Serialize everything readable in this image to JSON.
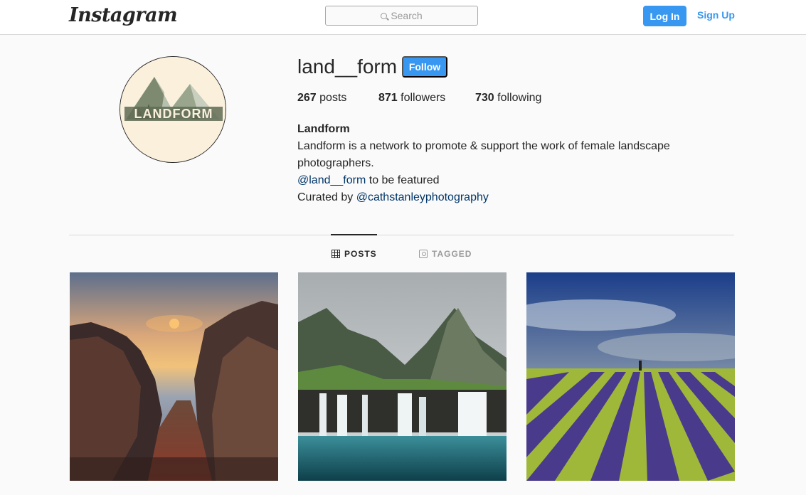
{
  "header": {
    "logo_text": "Instagram",
    "search_placeholder": "Search",
    "login_label": "Log In",
    "signup_label": "Sign Up"
  },
  "profile": {
    "username": "land__form",
    "follow_label": "Follow",
    "avatar_text": "LANDFORM",
    "stats": {
      "posts_count": "267",
      "posts_label": "posts",
      "followers_count": "871",
      "followers_label": "followers",
      "following_count": "730",
      "following_label": "following"
    },
    "bio": {
      "name": "Landform",
      "line1": "Landform is a network to promote & support the work of female landscape photographers.",
      "mention1": "@land__form",
      "mention1_suffix": " to be featured",
      "curated_prefix": "Curated by ",
      "mention2": "@cathstanleyphotography"
    }
  },
  "tabs": [
    {
      "label": "POSTS",
      "icon": "grid-icon",
      "active": true
    },
    {
      "label": "TAGGED",
      "icon": "tag-icon",
      "active": false
    }
  ],
  "posts": [
    {
      "subject": "sunset-cliffs"
    },
    {
      "subject": "waterfall-mountain"
    },
    {
      "subject": "lavender-field"
    }
  ],
  "colors": {
    "accent": "#3897f0",
    "link": "#003569",
    "text": "#262626",
    "muted": "#999999"
  }
}
